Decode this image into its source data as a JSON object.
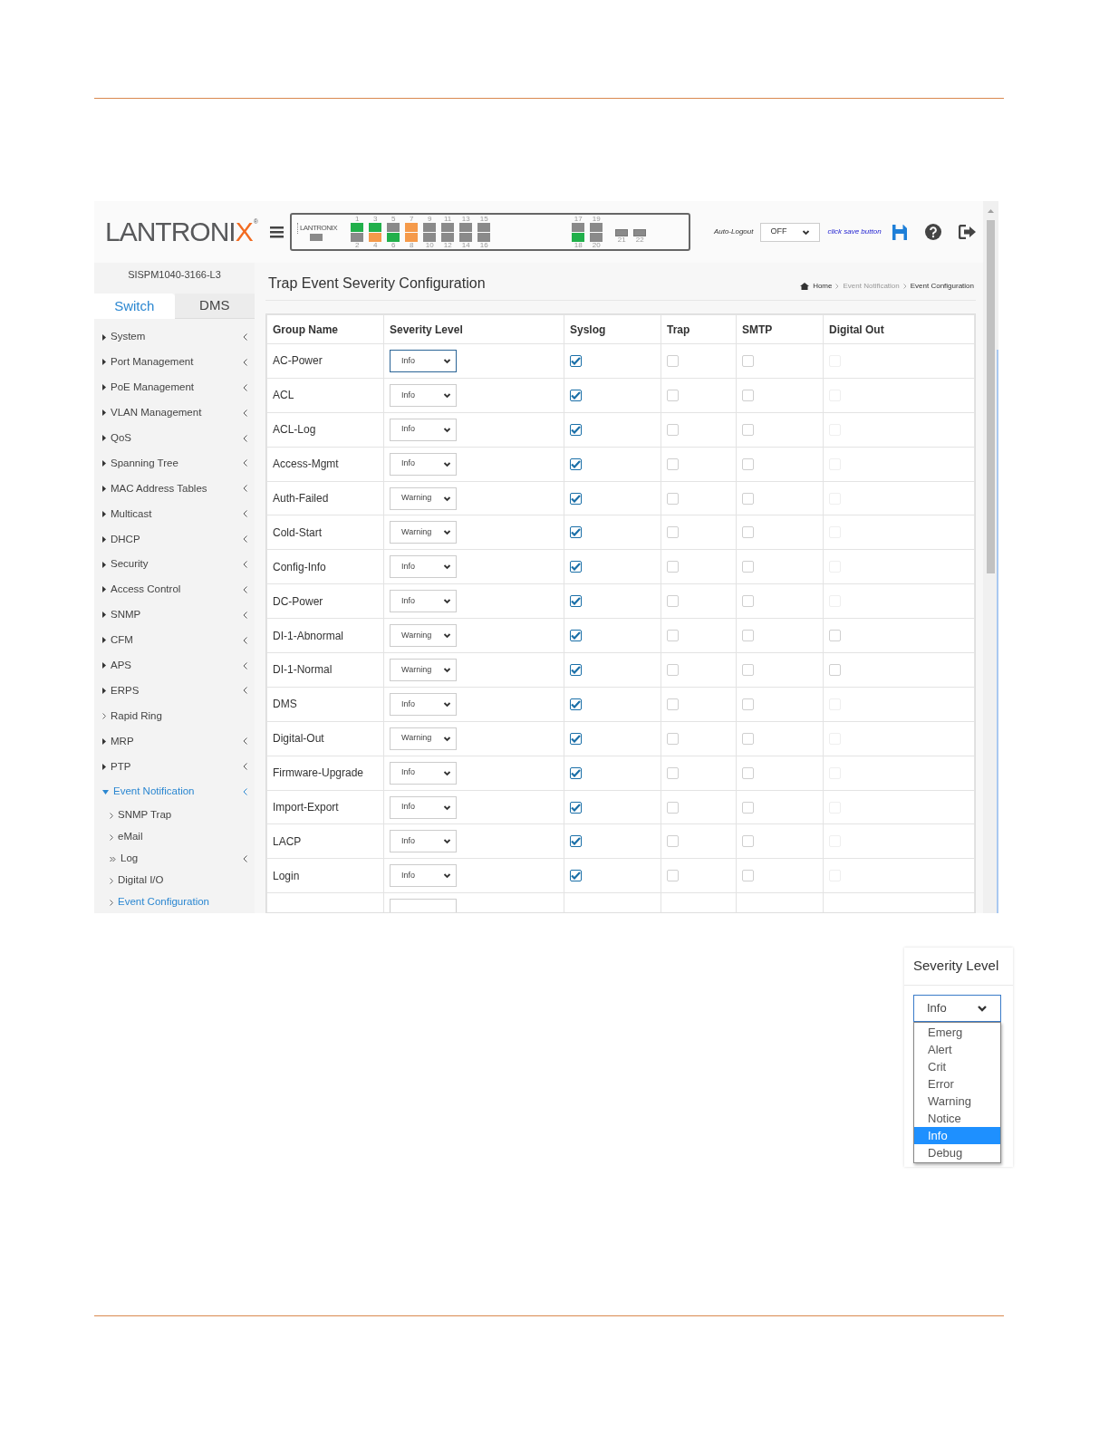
{
  "logo": {
    "text": "LANTRONI",
    "accent": "X",
    "mark": "®"
  },
  "port_panel": {
    "brand": "LANTRONIX",
    "ports": [
      {
        "label": "1",
        "color": "#22b04b"
      },
      {
        "label": "2",
        "color": "#8a8a8a"
      },
      {
        "label": "3",
        "color": "#22b04b"
      },
      {
        "label": "4",
        "color": "#f59a4a"
      },
      {
        "label": "5",
        "color": "#8a8a8a"
      },
      {
        "label": "6",
        "color": "#22b04b"
      },
      {
        "label": "7",
        "color": "#f59a4a"
      },
      {
        "label": "8",
        "color": "#f59a4a"
      },
      {
        "label": "9",
        "color": "#8a8a8a"
      },
      {
        "label": "10",
        "color": "#8a8a8a"
      },
      {
        "label": "11",
        "color": "#8a8a8a"
      },
      {
        "label": "12",
        "color": "#8a8a8a"
      },
      {
        "label": "13",
        "color": "#8a8a8a"
      },
      {
        "label": "14",
        "color": "#8a8a8a"
      },
      {
        "label": "15",
        "color": "#8a8a8a"
      },
      {
        "label": "16",
        "color": "#8a8a8a"
      }
    ],
    "uplinks": [
      {
        "label": "17",
        "color": "#8a8a8a"
      },
      {
        "label": "18",
        "color": "#22b04b"
      },
      {
        "label": "19",
        "color": "#8a8a8a"
      },
      {
        "label": "20",
        "color": "#8a8a8a"
      }
    ],
    "sfp": [
      {
        "label": "21"
      },
      {
        "label": "22"
      }
    ]
  },
  "auto_logout": {
    "label": "Auto-Logout",
    "value": "OFF"
  },
  "save_hint": "click save button",
  "model": "SISPM1040-3166-L3",
  "tabs": [
    {
      "label": "Switch",
      "selected": true
    },
    {
      "label": "DMS",
      "selected": false
    }
  ],
  "menu": [
    {
      "label": "System",
      "kind": "group",
      "expanded": false,
      "selected": false
    },
    {
      "label": "Port Management",
      "kind": "group",
      "expanded": false,
      "selected": false
    },
    {
      "label": "PoE Management",
      "kind": "group",
      "expanded": false,
      "selected": false
    },
    {
      "label": "VLAN Management",
      "kind": "group",
      "expanded": false,
      "selected": false
    },
    {
      "label": "QoS",
      "kind": "group",
      "expanded": false,
      "selected": false
    },
    {
      "label": "Spanning Tree",
      "kind": "group",
      "expanded": false,
      "selected": false
    },
    {
      "label": "MAC Address Tables",
      "kind": "group",
      "expanded": false,
      "selected": false
    },
    {
      "label": "Multicast",
      "kind": "group",
      "expanded": false,
      "selected": false
    },
    {
      "label": "DHCP",
      "kind": "group",
      "expanded": false,
      "selected": false
    },
    {
      "label": "Security",
      "kind": "group",
      "expanded": false,
      "selected": false
    },
    {
      "label": "Access Control",
      "kind": "group",
      "expanded": false,
      "selected": false
    },
    {
      "label": "SNMP",
      "kind": "group",
      "expanded": false,
      "selected": false
    },
    {
      "label": "CFM",
      "kind": "group",
      "expanded": false,
      "selected": false
    },
    {
      "label": "APS",
      "kind": "group",
      "expanded": false,
      "selected": false
    },
    {
      "label": "ERPS",
      "kind": "group",
      "expanded": false,
      "selected": false
    },
    {
      "label": "Rapid Ring",
      "kind": "link",
      "selected": false
    },
    {
      "label": "MRP",
      "kind": "group",
      "expanded": false,
      "selected": false
    },
    {
      "label": "PTP",
      "kind": "group",
      "expanded": false,
      "selected": false
    },
    {
      "label": "Event Notification",
      "kind": "group",
      "expanded": true,
      "selected": false,
      "children": [
        {
          "label": "SNMP Trap",
          "kind": "link",
          "selected": false
        },
        {
          "label": "eMail",
          "kind": "link",
          "selected": false
        },
        {
          "label": "Log",
          "kind": "group",
          "expanded": false,
          "selected": false
        },
        {
          "label": "Digital I/O",
          "kind": "link",
          "selected": false
        },
        {
          "label": "Event Configuration",
          "kind": "link",
          "selected": true
        }
      ]
    }
  ],
  "page_title": "Trap Event Severity Configuration",
  "breadcrumb": [
    {
      "label": "Home"
    },
    {
      "label": "Event Notification"
    },
    {
      "label": "Event Configuration"
    }
  ],
  "table": {
    "columns": [
      "Group Name",
      "Severity Level",
      "Syslog",
      "Trap",
      "SMTP",
      "Digital Out"
    ],
    "rows": [
      {
        "group": "AC-Power",
        "severity": "Info",
        "focused": true,
        "syslog": true,
        "trap": false,
        "smtp": false,
        "digital_out": false,
        "digital_out_disabled": true
      },
      {
        "group": "ACL",
        "severity": "Info",
        "focused": false,
        "syslog": true,
        "trap": false,
        "smtp": false,
        "digital_out": false,
        "digital_out_disabled": true
      },
      {
        "group": "ACL-Log",
        "severity": "Info",
        "focused": false,
        "syslog": true,
        "trap": false,
        "smtp": false,
        "digital_out": false,
        "digital_out_disabled": true
      },
      {
        "group": "Access-Mgmt",
        "severity": "Info",
        "focused": false,
        "syslog": true,
        "trap": false,
        "smtp": false,
        "digital_out": false,
        "digital_out_disabled": true
      },
      {
        "group": "Auth-Failed",
        "severity": "Warning",
        "focused": false,
        "syslog": true,
        "trap": false,
        "smtp": false,
        "digital_out": false,
        "digital_out_disabled": true
      },
      {
        "group": "Cold-Start",
        "severity": "Warning",
        "focused": false,
        "syslog": true,
        "trap": false,
        "smtp": false,
        "digital_out": false,
        "digital_out_disabled": true
      },
      {
        "group": "Config-Info",
        "severity": "Info",
        "focused": false,
        "syslog": true,
        "trap": false,
        "smtp": false,
        "digital_out": false,
        "digital_out_disabled": true
      },
      {
        "group": "DC-Power",
        "severity": "Info",
        "focused": false,
        "syslog": true,
        "trap": false,
        "smtp": false,
        "digital_out": false,
        "digital_out_disabled": true
      },
      {
        "group": "DI-1-Abnormal",
        "severity": "Warning",
        "focused": false,
        "syslog": true,
        "trap": false,
        "smtp": false,
        "digital_out": false,
        "digital_out_disabled": false
      },
      {
        "group": "DI-1-Normal",
        "severity": "Warning",
        "focused": false,
        "syslog": true,
        "trap": false,
        "smtp": false,
        "digital_out": false,
        "digital_out_disabled": false
      },
      {
        "group": "DMS",
        "severity": "Info",
        "focused": false,
        "syslog": true,
        "trap": false,
        "smtp": false,
        "digital_out": false,
        "digital_out_disabled": true
      },
      {
        "group": "Digital-Out",
        "severity": "Warning",
        "focused": false,
        "syslog": true,
        "trap": false,
        "smtp": false,
        "digital_out": false,
        "digital_out_disabled": true
      },
      {
        "group": "Firmware-Upgrade",
        "severity": "Info",
        "focused": false,
        "syslog": true,
        "trap": false,
        "smtp": false,
        "digital_out": false,
        "digital_out_disabled": true
      },
      {
        "group": "Import-Export",
        "severity": "Info",
        "focused": false,
        "syslog": true,
        "trap": false,
        "smtp": false,
        "digital_out": false,
        "digital_out_disabled": true
      },
      {
        "group": "LACP",
        "severity": "Info",
        "focused": false,
        "syslog": true,
        "trap": false,
        "smtp": false,
        "digital_out": false,
        "digital_out_disabled": true
      },
      {
        "group": "Login",
        "severity": "Info",
        "focused": false,
        "syslog": true,
        "trap": false,
        "smtp": false,
        "digital_out": false,
        "digital_out_disabled": true
      }
    ]
  },
  "dropdown_inset": {
    "header": "Severity Level",
    "value": "Info",
    "options": [
      {
        "label": "Emerg",
        "selected": false
      },
      {
        "label": "Alert",
        "selected": false
      },
      {
        "label": "Crit",
        "selected": false
      },
      {
        "label": "Error",
        "selected": false
      },
      {
        "label": "Warning",
        "selected": false
      },
      {
        "label": "Notice",
        "selected": false
      },
      {
        "label": "Info",
        "selected": true
      },
      {
        "label": "Debug",
        "selected": false
      }
    ]
  }
}
